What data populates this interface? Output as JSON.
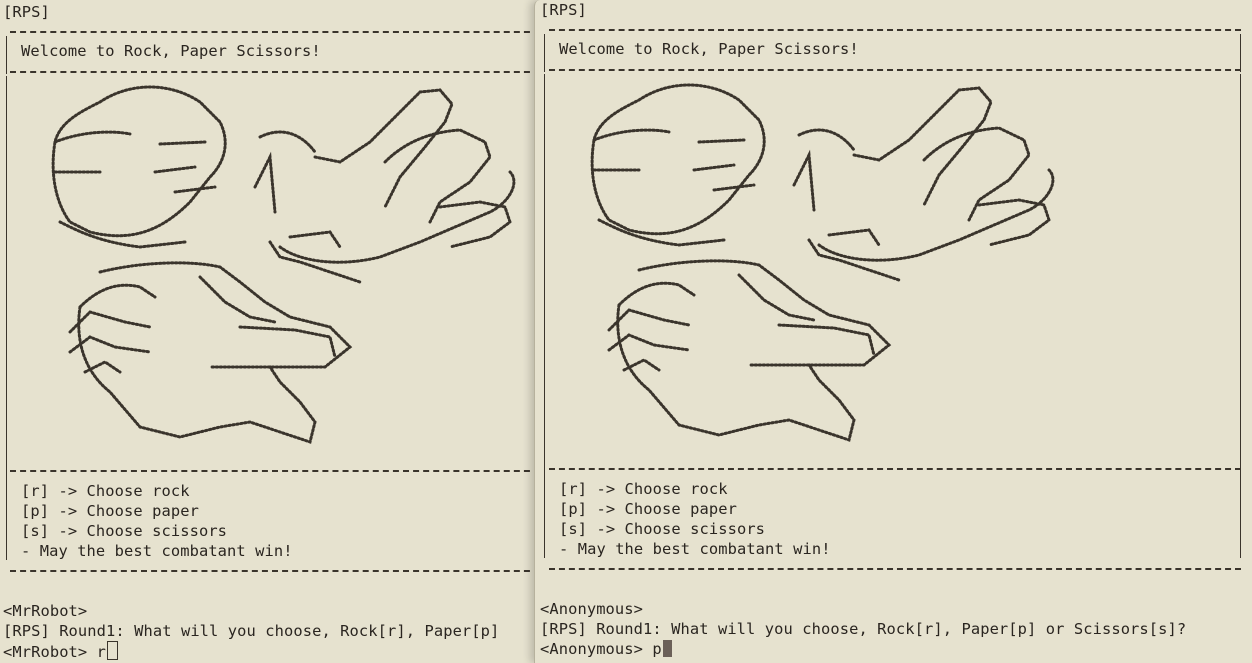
{
  "left_terminal": {
    "tag": "[RPS]",
    "welcome": "Welcome to Rock, Paper Scissors!",
    "menu": [
      "[r] -> Choose rock",
      "[p] -> Choose paper",
      "[s] -> Choose scissors",
      "- May the best combatant win!"
    ],
    "player_tag": "<MrRobot>",
    "round_prompt": "[RPS] Round1: What will you choose, Rock[r], Paper[p]",
    "input_prompt": "<MrRobot>",
    "input_value": "r"
  },
  "right_terminal": {
    "tag": "[RPS]",
    "welcome": "Welcome to Rock, Paper Scissors!",
    "menu": [
      "[r] -> Choose rock",
      "[p] -> Choose paper",
      "[s] -> Choose scissors",
      "- May the best combatant win!"
    ],
    "player_tag": "<Anonymous>",
    "round_prompt": "[RPS] Round1: What will you choose, Rock[r], Paper[p] or Scissors[s]?",
    "input_prompt": "<Anonymous>",
    "input_value": "p"
  }
}
